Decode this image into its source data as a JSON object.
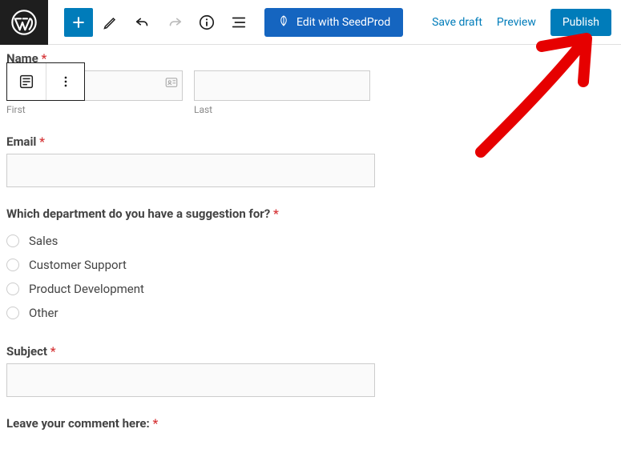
{
  "toolbar": {
    "seedprod_label": "Edit with SeedProd",
    "save_draft": "Save draft",
    "preview": "Preview",
    "publish": "Publish"
  },
  "form": {
    "name": {
      "label": "Name",
      "first_sub": "First",
      "last_sub": "Last"
    },
    "email": {
      "label": "Email"
    },
    "department": {
      "label": "Which department do you have a suggestion for?",
      "options": [
        "Sales",
        "Customer Support",
        "Product Development",
        "Other"
      ]
    },
    "subject": {
      "label": "Subject"
    },
    "comment": {
      "label": "Leave your comment here:"
    }
  }
}
